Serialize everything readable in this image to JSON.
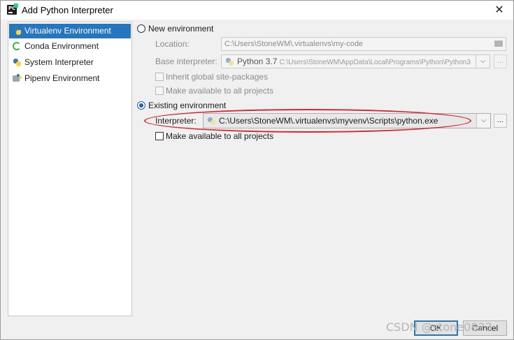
{
  "window": {
    "title": "Add Python Interpreter",
    "close_glyph": "✕"
  },
  "sidebar": {
    "items": [
      {
        "label": "Virtualenv Environment",
        "icon": "python-virtualenv-icon",
        "selected": true
      },
      {
        "label": "Conda Environment",
        "icon": "conda-icon",
        "selected": false
      },
      {
        "label": "System Interpreter",
        "icon": "python-icon",
        "selected": false
      },
      {
        "label": "Pipenv Environment",
        "icon": "pipenv-icon",
        "selected": false
      }
    ]
  },
  "new_env": {
    "radio_label": "New environment",
    "selected": false,
    "location_label": "Location:",
    "location_value": "C:\\Users\\StoneWM\\.virtualenvs\\my-code",
    "base_label": "Base interpreter:",
    "base_value_name": "Python 3.7",
    "base_value_path": "C:\\Users\\StoneWM\\AppData\\Local\\Programs\\Python\\Python3",
    "inherit_label": "Inherit global site-packages",
    "available_label": "Make available to all projects",
    "ellipsis": "..."
  },
  "existing_env": {
    "radio_label": "Existing environment",
    "selected": true,
    "interpreter_label": "Interpreter:",
    "interpreter_value": "C:\\Users\\StoneWM\\.virtualenvs\\myvenv\\Scripts\\python.exe",
    "available_label": "Make available to all projects",
    "browse_label": "...",
    "dropdown_glyph": "⌵"
  },
  "footer": {
    "ok_label": "OK",
    "cancel_label": "Cancel",
    "watermark": "CSDN @stone0823"
  },
  "colors": {
    "selection": "#2675bf",
    "highlight_ellipse": "#d8262e"
  }
}
